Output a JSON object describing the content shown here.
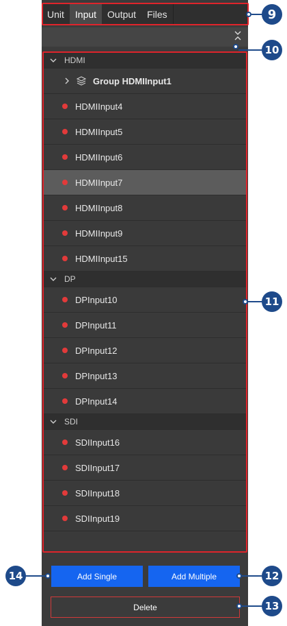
{
  "tabs": [
    {
      "label": "Unit",
      "active": false
    },
    {
      "label": "Input",
      "active": true
    },
    {
      "label": "Output",
      "active": false
    },
    {
      "label": "Files",
      "active": false
    }
  ],
  "list": {
    "hdmi_group": {
      "label": "HDMI",
      "subgroup": "Group HDMIInput1",
      "items": [
        "HDMIInput4",
        "HDMIInput5",
        "HDMIInput6",
        "HDMIInput7",
        "HDMIInput8",
        "HDMIInput9",
        "HDMIInput15"
      ],
      "selected_item": "HDMIInput7"
    },
    "dp_group": {
      "label": "DP",
      "items": [
        "DPInput10",
        "DPInput11",
        "DPInput12",
        "DPInput13",
        "DPInput14"
      ]
    },
    "sdi_group": {
      "label": "SDI",
      "items": [
        "SDIInput16",
        "SDIInput17",
        "SDIInput18",
        "SDIInput19"
      ]
    },
    "status_color": "#e23a3a"
  },
  "buttons": {
    "add_single": "Add Single",
    "add_multiple": "Add Multiple",
    "delete": "Delete"
  },
  "callouts": {
    "tabs": "9",
    "collapse": "10",
    "list": "11",
    "add_multiple": "12",
    "delete": "13",
    "add_single": "14"
  },
  "colors": {
    "accent": "#1565f0",
    "callout": "#1e4a8a",
    "highlight": "#e0242b"
  }
}
